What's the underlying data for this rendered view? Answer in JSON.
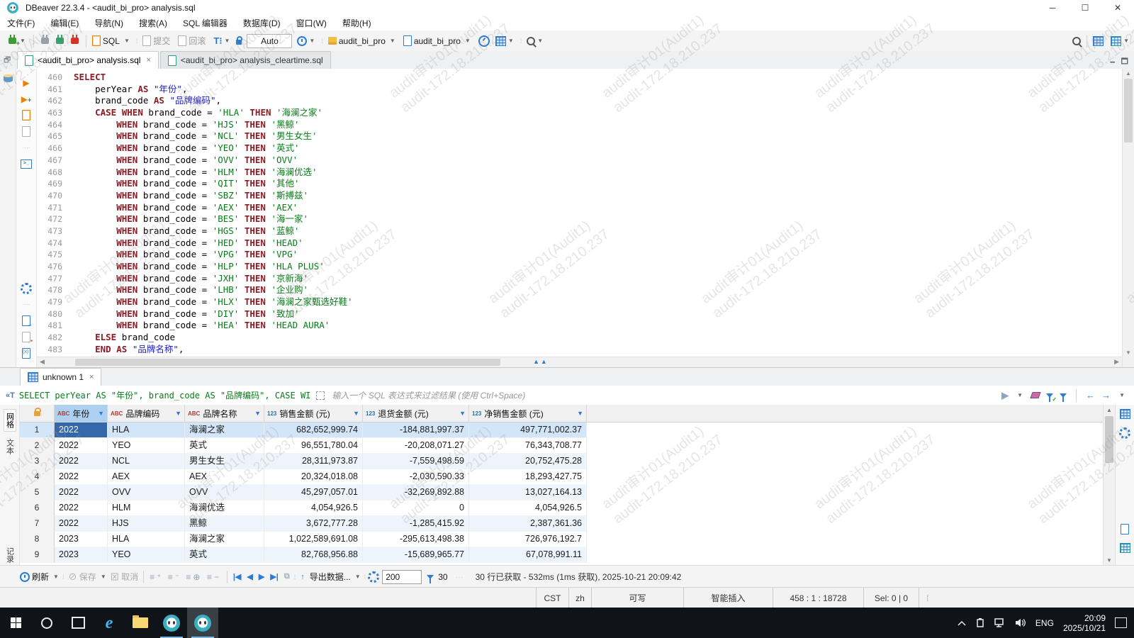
{
  "colors": {
    "accent": "#2c7bd4",
    "keyword": "#8b1c24",
    "string": "#067d17",
    "quoted_identifier": "#1a1acd",
    "selection": "#3568a8",
    "row_stripe": "#eef4fb",
    "selected_row": "#d3e5f8"
  },
  "window": {
    "title": "DBeaver 22.3.4 - <audit_bi_pro> analysis.sql",
    "minimize": "─",
    "maximize": "☐",
    "close": "✕"
  },
  "menu": [
    "文件(F)",
    "编辑(E)",
    "导航(N)",
    "搜索(A)",
    "SQL 编辑器",
    "数据库(D)",
    "窗口(W)",
    "帮助(H)"
  ],
  "toolbar": {
    "sql_label": "SQL",
    "commit_label": "提交",
    "rollback_label": "回滚",
    "tx_mode": "Auto",
    "database": "audit_bi_pro",
    "schema": "audit_bi_pro"
  },
  "editor_tabs": [
    {
      "label": "<audit_bi_pro> analysis.sql",
      "active": true
    },
    {
      "label": "<audit_bi_pro> analysis_cleartime.sql",
      "active": false
    }
  ],
  "editor": {
    "lines": [
      {
        "no": 460,
        "text": "SELECT"
      },
      {
        "no": 461,
        "text": "    perYear AS \"年份\","
      },
      {
        "no": 462,
        "text": "    brand_code AS \"品牌编码\","
      },
      {
        "no": 463,
        "text": "    CASE WHEN brand_code = 'HLA' THEN '海澜之家'"
      },
      {
        "no": 464,
        "text": "        WHEN brand_code = 'HJS' THEN '黑鲸'"
      },
      {
        "no": 465,
        "text": "        WHEN brand_code = 'NCL' THEN '男生女生'"
      },
      {
        "no": 466,
        "text": "        WHEN brand_code = 'YEO' THEN '英式'"
      },
      {
        "no": 467,
        "text": "        WHEN brand_code = 'OVV' THEN 'OVV'"
      },
      {
        "no": 468,
        "text": "        WHEN brand_code = 'HLM' THEN '海澜优选'"
      },
      {
        "no": 469,
        "text": "        WHEN brand_code = 'QIT' THEN '其他'"
      },
      {
        "no": 470,
        "text": "        WHEN brand_code = 'SBZ' THEN '斯搏兹'"
      },
      {
        "no": 471,
        "text": "        WHEN brand_code = 'AEX' THEN 'AEX'"
      },
      {
        "no": 472,
        "text": "        WHEN brand_code = 'BES' THEN '海一家'"
      },
      {
        "no": 473,
        "text": "        WHEN brand_code = 'HGS' THEN '蓝鲸'"
      },
      {
        "no": 474,
        "text": "        WHEN brand_code = 'HED' THEN 'HEAD'"
      },
      {
        "no": 475,
        "text": "        WHEN brand_code = 'VPG' THEN 'VPG'"
      },
      {
        "no": 476,
        "text": "        WHEN brand_code = 'HLP' THEN 'HLA PLUS'"
      },
      {
        "no": 477,
        "text": "        WHEN brand_code = 'JXH' THEN '京新海'"
      },
      {
        "no": 478,
        "text": "        WHEN brand_code = 'LHB' THEN '企业购'"
      },
      {
        "no": 479,
        "text": "        WHEN brand_code = 'HLX' THEN '海澜之家甄选好鞋'"
      },
      {
        "no": 480,
        "text": "        WHEN brand_code = 'DIY' THEN '致加'"
      },
      {
        "no": 481,
        "text": "        WHEN brand_code = 'HEA' THEN 'HEAD AURA'"
      },
      {
        "no": 482,
        "text": "    ELSE brand_code"
      },
      {
        "no": 483,
        "text": "    END AS \"品牌名称\","
      }
    ]
  },
  "results": {
    "tab_label": "unknown 1",
    "filter_query": "SELECT perYear AS \"年份\", brand_code AS \"品牌编码\", CASE WI",
    "filter_placeholder": "输入一个 SQL 表达式来过滤结果 (使用 Ctrl+Space)",
    "side_tabs": [
      "网格",
      "文本"
    ],
    "side_bottom_label": "记录",
    "grid": {
      "columns": [
        {
          "type": "ABC",
          "label": "年份"
        },
        {
          "type": "ABC",
          "label": "品牌编码"
        },
        {
          "type": "ABC",
          "label": "品牌名称"
        },
        {
          "type": "123",
          "label": "销售金额 (元)"
        },
        {
          "type": "123",
          "label": "退货金额 (元)"
        },
        {
          "type": "123",
          "label": "净销售金额 (元)"
        }
      ],
      "rows": [
        [
          "2022",
          "HLA",
          "海澜之家",
          "682,652,999.74",
          "-184,881,997.37",
          "497,771,002.37"
        ],
        [
          "2022",
          "YEO",
          "英式",
          "96,551,780.04",
          "-20,208,071.27",
          "76,343,708.77"
        ],
        [
          "2022",
          "NCL",
          "男生女生",
          "28,311,973.87",
          "-7,559,498.59",
          "20,752,475.28"
        ],
        [
          "2022",
          "AEX",
          "AEX",
          "20,324,018.08",
          "-2,030,590.33",
          "18,293,427.75"
        ],
        [
          "2022",
          "OVV",
          "OVV",
          "45,297,057.01",
          "-32,269,892.88",
          "13,027,164.13"
        ],
        [
          "2022",
          "HLM",
          "海澜优选",
          "4,054,926.5",
          "0",
          "4,054,926.5"
        ],
        [
          "2022",
          "HJS",
          "黑鲸",
          "3,672,777.28",
          "-1,285,415.92",
          "2,387,361.36"
        ],
        [
          "2023",
          "HLA",
          "海澜之家",
          "1,022,589,691.08",
          "-295,613,498.38",
          "726,976,192.7"
        ],
        [
          "2023",
          "YEO",
          "英式",
          "82,768,956.88",
          "-15,689,965.77",
          "67,078,991.11"
        ]
      ],
      "selected_cell": {
        "row": 0,
        "col": 0
      }
    },
    "toolbar": {
      "refresh_label": "刷新",
      "save_label": "保存",
      "cancel_label": "取消",
      "export_label": "导出数据...",
      "fetch_size": "200",
      "filter_count": "30",
      "status": "30 行已获取 - 532ms (1ms 获取), 2025-10-21 20:09:42"
    }
  },
  "statusbar": {
    "segments": [
      "CST",
      "zh",
      "可写",
      "智能插入",
      "458 : 1 : 18728",
      "Sel: 0 | 0"
    ]
  },
  "taskbar": {
    "lang": "ENG",
    "time": "20:09",
    "date": "2025/10/21"
  },
  "watermark": {
    "line1": "audit审计01(Audit1)",
    "line2": "audit-172.18.210.237"
  }
}
